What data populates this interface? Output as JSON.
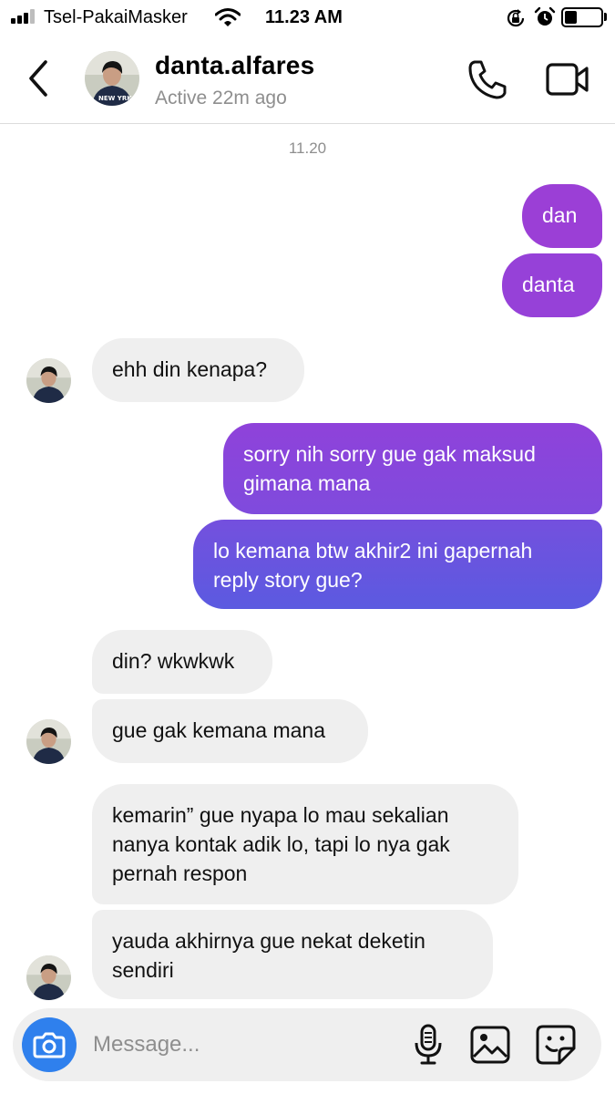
{
  "status_bar": {
    "carrier": "Tsel-PakaiMasker",
    "time": "11.23 AM",
    "battery_level": 0.35,
    "icons": [
      "signal-icon",
      "wifi-icon",
      "orientation-lock-icon",
      "alarm-icon",
      "battery-icon"
    ]
  },
  "header": {
    "username": "danta.alfares",
    "status": "Active 22m ago",
    "icons": [
      "back-arrow-icon",
      "phone-icon",
      "video-camera-icon"
    ]
  },
  "conversation": {
    "timestamp": "11.20",
    "messages": [
      {
        "from": "me",
        "text": "dan"
      },
      {
        "from": "me",
        "text": "danta"
      },
      {
        "from": "them",
        "text": "ehh din kenapa?"
      },
      {
        "from": "me",
        "lines": [
          "sorry nih sorry gue gak maksud",
          "gimana mana"
        ]
      },
      {
        "from": "me",
        "lines": [
          "lo kemana btw akhir2 ini gapernah",
          "reply story gue?"
        ]
      },
      {
        "from": "them",
        "text": "din? wkwkwk"
      },
      {
        "from": "them",
        "text": "gue gak kemana mana"
      },
      {
        "from": "them",
        "lines": [
          "kemarin” gue nyapa lo mau sekalian",
          "nanya kontak adik lo, tapi lo nya gak",
          "pernah respon"
        ]
      },
      {
        "from": "them",
        "lines": [
          "yauda akhirnya gue nekat deketin",
          "sendiri"
        ]
      }
    ]
  },
  "composer": {
    "placeholder": "Message...",
    "icons": [
      "camera-icon",
      "microphone-icon",
      "gallery-icon",
      "sticker-icon"
    ]
  },
  "colors": {
    "outgoing_top": "#9b3fd6",
    "outgoing_bottom": "#5b5ae0",
    "incoming": "#efefef",
    "camera_button": "#2f80ed",
    "secondary_text": "#8e8e8e"
  }
}
